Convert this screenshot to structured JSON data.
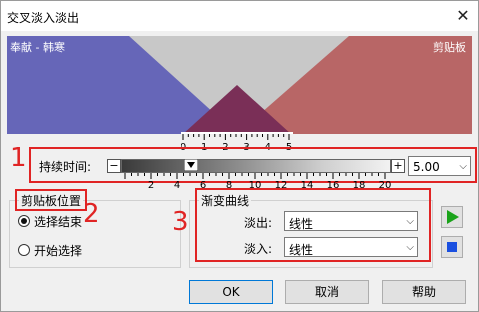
{
  "window": {
    "title": "交叉淡入淡出",
    "close_glyph": "✕"
  },
  "preview": {
    "left_label": "奉献 - 韩寒",
    "right_label": "剪贴板",
    "fade_in_color": "#6666b8",
    "fade_out_color": "#b86666",
    "overlap_color": "#7a2f57",
    "background_color": "#c8c8c8"
  },
  "ruler_top": {
    "ticks": [
      "0",
      "1",
      "2",
      "3",
      "4",
      "5"
    ]
  },
  "duration": {
    "label": "持续时间:",
    "minus": "−",
    "plus": "+",
    "value": "5.00",
    "fraction": 0.34
  },
  "ruler_bottom": {
    "ticks": [
      "2",
      "4",
      "6",
      "8",
      "10",
      "12",
      "14",
      "16",
      "18",
      "20"
    ]
  },
  "annotations": {
    "n1": "1",
    "n2": "2",
    "n3": "3"
  },
  "clipboard_position": {
    "title": "剪贴板位置",
    "options": [
      {
        "label": "选择结束",
        "checked": true
      },
      {
        "label": "开始选择",
        "checked": false
      }
    ]
  },
  "curve": {
    "title": "渐变曲线",
    "fade_out_label": "淡出:",
    "fade_out_value": "线性",
    "fade_in_label": "淡入:",
    "fade_in_value": "线性"
  },
  "icons": {
    "play": "play-icon",
    "stop": "stop-icon",
    "play_color": "#1aa31a",
    "stop_color": "#1a4fe0"
  },
  "buttons": {
    "ok": "OK",
    "cancel": "取消",
    "help": "帮助"
  }
}
